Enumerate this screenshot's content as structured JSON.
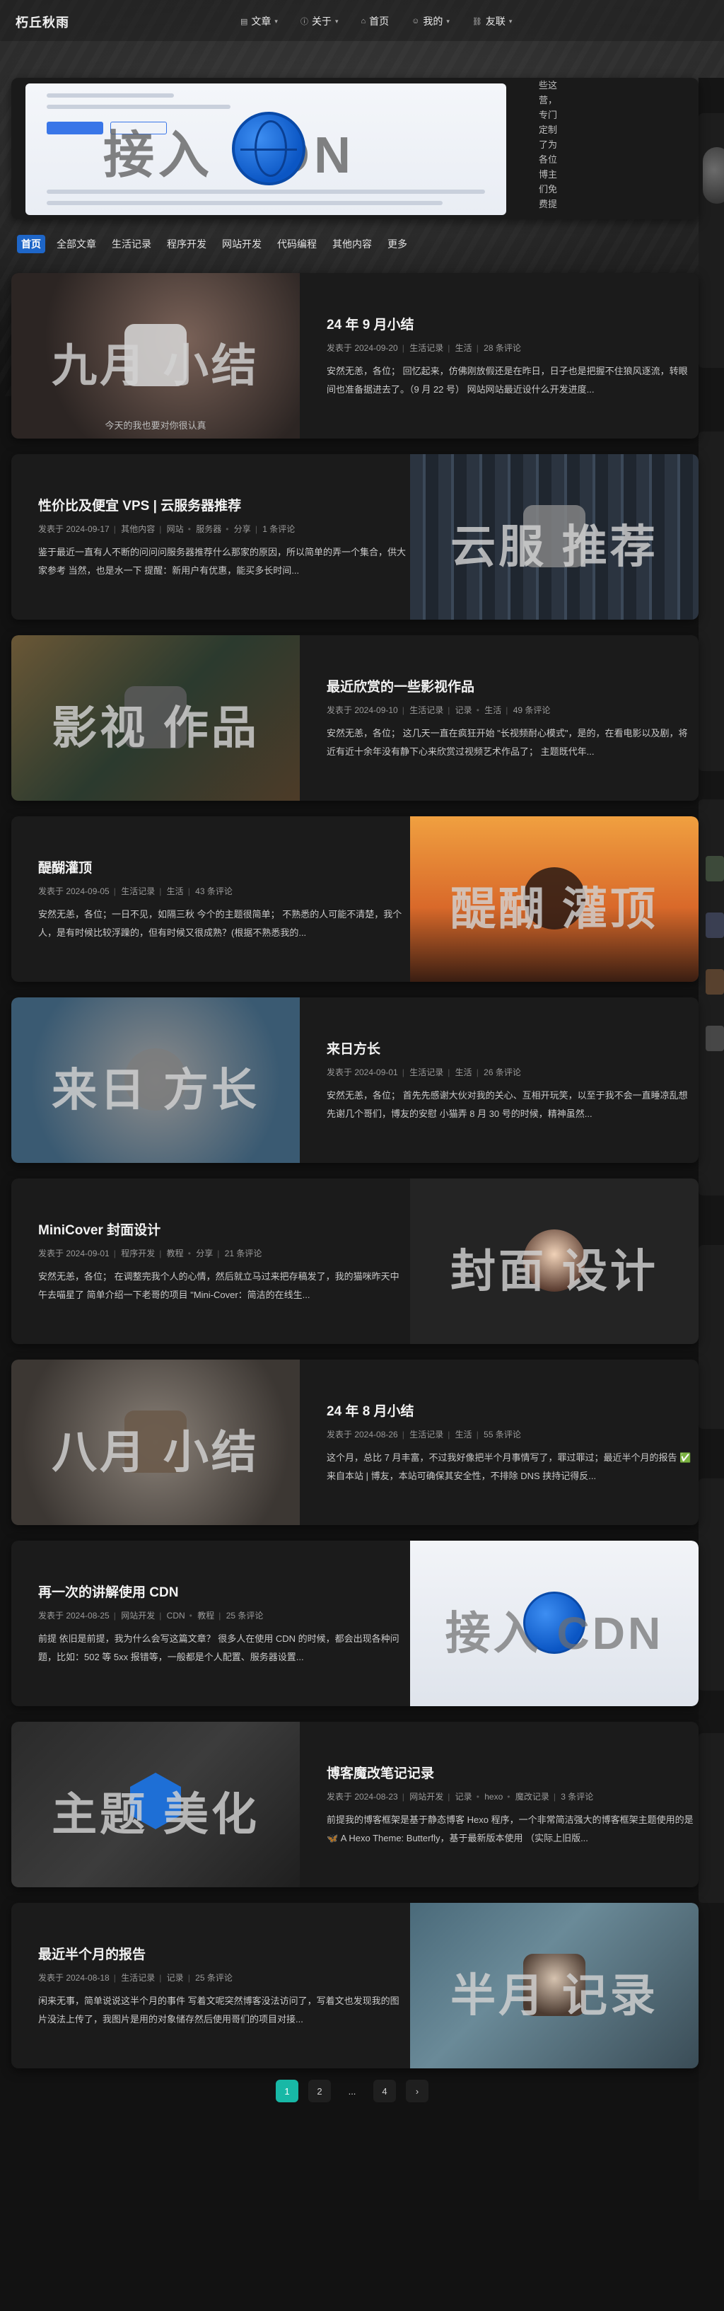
{
  "site": {
    "brand": "朽丘秋雨"
  },
  "nav": {
    "items": [
      {
        "label": "文章",
        "icon": "book-icon",
        "has_dropdown": true
      },
      {
        "label": "关于",
        "icon": "info-icon",
        "has_dropdown": true
      },
      {
        "label": "首页",
        "icon": "home-icon",
        "has_dropdown": false
      },
      {
        "label": "我的",
        "icon": "user-icon",
        "has_dropdown": true
      },
      {
        "label": "友联",
        "icon": "link-icon",
        "has_dropdown": true
      }
    ]
  },
  "banner": {
    "overlay_text": "接入  CDN",
    "side_text": "些这营，专门定制了为各位博主们免费提"
  },
  "tabs": [
    "首页",
    "全部文章",
    "生活记录",
    "程序开发",
    "网站开发",
    "代码编程",
    "其他内容",
    "更多"
  ],
  "posts": [
    {
      "title": "24 年 9 月小结",
      "cover_text": "九月  小结",
      "cover_caption": "今天的我也要对你很认真",
      "date": "发表于 2024-09-20",
      "cats": [
        "生活记录",
        "生活"
      ],
      "comments": "28 条评论",
      "excerpt": "安然无恙，各位； 回忆起来，仿佛刚放假还是在昨日，日子也是把握不住狼风逐流，转眼间也准备据进去了。（9 月 22 号） 网站网站最近设什么开发进度..."
    },
    {
      "title": "性价比及便宜 VPS | 云服务器推荐",
      "cover_text": "云服  推荐",
      "date": "发表于 2024-09-17",
      "cats": [
        "其他内容",
        "网站",
        "服务器",
        "分享"
      ],
      "comments": "1 条评论",
      "excerpt": "鉴于最近一直有人不断的问问问服务器推荐什么那家的原因，所以简单的弄一个集合，供大家参考 当然，也是水一下 提醒：新用户有优惠，能买多长时间..."
    },
    {
      "title": "最近欣赏的一些影视作品",
      "cover_text": "影视  作品",
      "date": "发表于 2024-09-10",
      "cats": [
        "生活记录",
        "记录",
        "生活"
      ],
      "comments": "49 条评论",
      "excerpt": "安然无恙，各位； 这几天一直在疯狂开始 \"长视频耐心模式\"，是的，在看电影以及剧，将近有近十余年没有静下心来欣赏过视频艺术作品了； 主题既代年..."
    },
    {
      "title": "醍醐灌顶",
      "cover_text": "醍醐  灌顶",
      "date": "发表于 2024-09-05",
      "cats": [
        "生活记录",
        "生活"
      ],
      "comments": "43 条评论",
      "excerpt": "安然无恙，各位；一日不见，如隔三秋 今个的主题很简单； 不熟悉的人可能不清楚，我个人，是有时候比较浮躁的，但有时候又很成熟？(根据不熟悉我的..."
    },
    {
      "title": "来日方长",
      "cover_text": "来日  方长",
      "date": "发表于 2024-09-01",
      "cats": [
        "生活记录",
        "生活"
      ],
      "comments": "26 条评论",
      "excerpt": "安然无恙，各位； 首先先感谢大伙对我的关心、互相开玩笑，以至于我不会一直睡凉乱想 先谢几个哥们，博友的安慰 小猫弄 8 月 30 号的时候，精神虽然..."
    },
    {
      "title": "MiniCover 封面设计",
      "cover_text": "封面  设计",
      "date": "发表于 2024-09-01",
      "cats": [
        "程序开发",
        "教程",
        "分享"
      ],
      "comments": "21 条评论",
      "excerpt": "安然无恙，各位； 在调整完我个人的心情，然后就立马过来把存稿发了，我的猫咪昨天中午去喵星了 简单介绍一下老哥的项目 \"Mini-Cover：简洁的在线生..."
    },
    {
      "title": "24 年 8 月小结",
      "cover_text": "八月  小结",
      "date": "发表于 2024-08-26",
      "cats": [
        "生活记录",
        "生活"
      ],
      "comments": "55 条评论",
      "excerpt": "这个月，总比 7 月丰富，不过我好像把半个月事情写了，罪过罪过；最近半个月的报告 ✅来自本站 | 博友，本站可确保其安全性，不排除 DNS 挟持记得反..."
    },
    {
      "title": "再一次的讲解使用 CDN",
      "cover_text": "接入  CDN",
      "date": "发表于 2024-08-25",
      "cats": [
        "网站开发",
        "CDN",
        "教程"
      ],
      "comments": "25 条评论",
      "excerpt": "前提 依旧是前提，我为什么会写这篇文章？ 很多人在使用 CDN 的时候，都会出现各种问题，比如：502 等 5xx 报错等，一般都是个人配置、服务器设置..."
    },
    {
      "title": "博客魔改笔记记录",
      "cover_text": "主题  美化",
      "date": "发表于 2024-08-23",
      "cats": [
        "网站开发",
        "记录",
        "hexo",
        "魔改记录"
      ],
      "comments": "3 条评论",
      "excerpt": "前提我的博客框架是基于静态博客 Hexo 程序，一个非常简洁强大的博客框架主题使用的是 🦋 A Hexo Theme: Butterfly，基于最新版本使用 （实际上旧版..."
    },
    {
      "title": "最近半个月的报告",
      "cover_text": "半月  记录",
      "date": "发表于 2024-08-18",
      "cats": [
        "生活记录",
        "记录"
      ],
      "comments": "25 条评论",
      "excerpt": "闲来无事，简单说说这半个月的事件 写着文呢突然博客没法访问了，写着文也发现我的图片没法上传了，我图片是用的对象储存然后使用哥们的项目对接..."
    }
  ],
  "pagination": {
    "pages": [
      "1",
      "2",
      "...",
      "4"
    ],
    "current": "1",
    "next_icon": "chevron-right-icon"
  }
}
